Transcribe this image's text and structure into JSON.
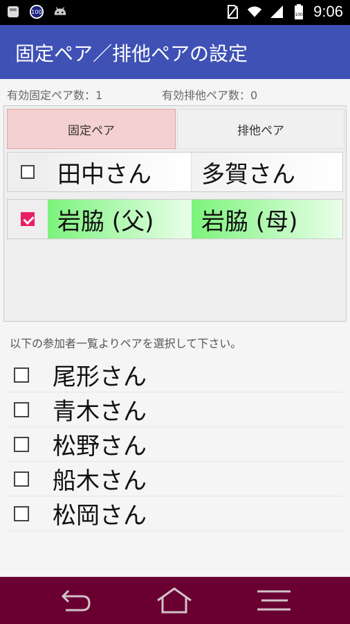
{
  "status_bar": {
    "time": "9:06",
    "left_icons": [
      "app-icon",
      "battery-100-icon",
      "android-icon"
    ],
    "right_icons": [
      "no-sim-icon",
      "wifi-icon",
      "signal-icon",
      "battery-icon"
    ]
  },
  "app_bar": {
    "title": "固定ペア／排他ペアの設定"
  },
  "counts": {
    "fixed_label": "有効固定ペア数：1",
    "exclusive_label": "有効排他ペア数：0"
  },
  "tabs": [
    {
      "label": "固定ペア",
      "selected": true
    },
    {
      "label": "排他ペア",
      "selected": false
    }
  ],
  "pairs": [
    {
      "checked": false,
      "a": "田中さん",
      "b": "多賀さん"
    },
    {
      "checked": true,
      "a": "岩脇 (父)",
      "b": "岩脇 (母)"
    }
  ],
  "instruction": "以下の参加者一覧よりペアを選択して下さい。",
  "participants": [
    {
      "name": "尾形さん",
      "checked": false
    },
    {
      "name": "青木さん",
      "checked": false
    },
    {
      "name": "松野さん",
      "checked": false
    },
    {
      "name": "船木さん",
      "checked": false
    },
    {
      "name": "松岡さん",
      "checked": false
    }
  ],
  "nav_icons": [
    "back-icon",
    "home-icon",
    "menu-icon"
  ],
  "colors": {
    "app_bar": "#3f51b5",
    "selected_tab": "#f5d0d0",
    "active_pair": "#7cf37c",
    "checkbox_checked": "#e91e63",
    "nav_bar": "#6a0032"
  }
}
